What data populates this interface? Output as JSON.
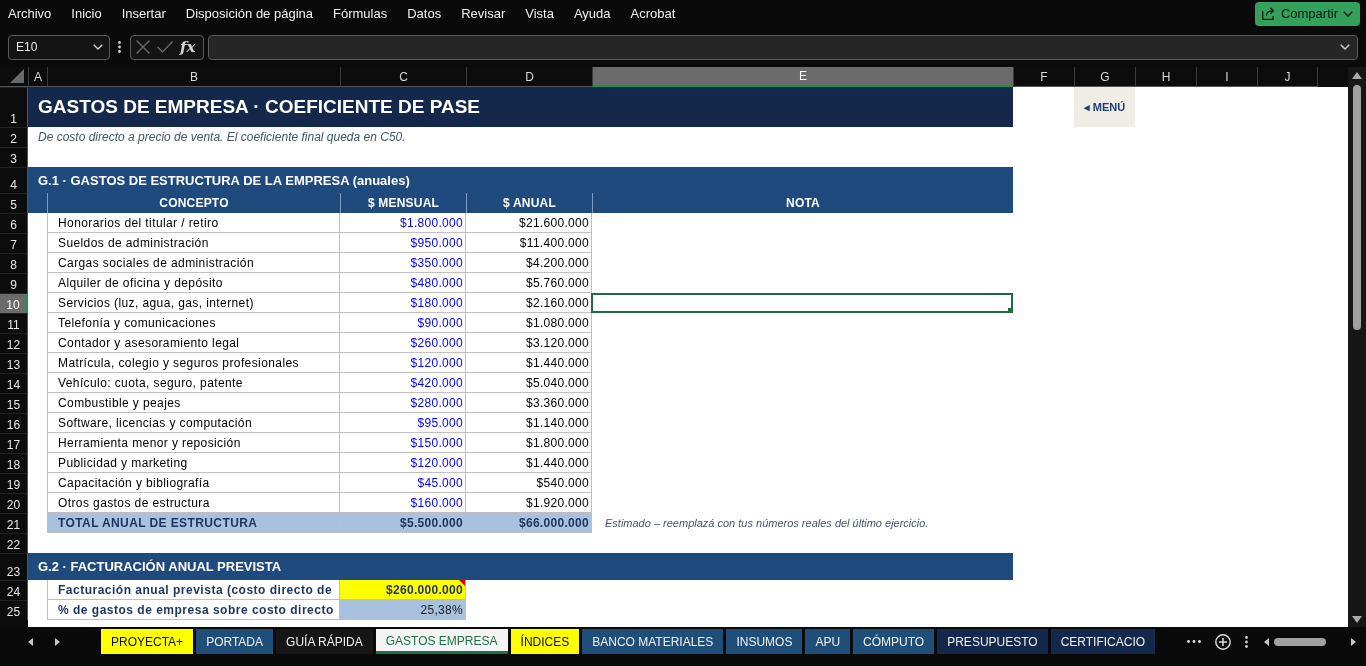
{
  "menu_bar": {
    "items": [
      "Archivo",
      "Inicio",
      "Insertar",
      "Disposición de página",
      "Fórmulas",
      "Datos",
      "Revisar",
      "Vista",
      "Ayuda",
      "Acrobat"
    ],
    "share_button": "Compartir"
  },
  "formula_bar": {
    "name_box": "E10",
    "function_button": "fx"
  },
  "column_headers": [
    {
      "label": "A",
      "selected": false
    },
    {
      "label": "B",
      "selected": false
    },
    {
      "label": "C",
      "selected": false
    },
    {
      "label": "D",
      "selected": false
    },
    {
      "label": "E",
      "selected": true
    },
    {
      "label": "F",
      "selected": false
    },
    {
      "label": "G",
      "selected": false
    },
    {
      "label": "H",
      "selected": false
    },
    {
      "label": "I",
      "selected": false
    },
    {
      "label": "J",
      "selected": false
    }
  ],
  "row_headers": [
    {
      "label": "1",
      "selected": false
    },
    {
      "label": "2",
      "selected": false
    },
    {
      "label": "3",
      "selected": false
    },
    {
      "label": "4",
      "selected": false
    },
    {
      "label": "5",
      "selected": false
    },
    {
      "label": "6",
      "selected": false
    },
    {
      "label": "7",
      "selected": false
    },
    {
      "label": "8",
      "selected": false
    },
    {
      "label": "9",
      "selected": false
    },
    {
      "label": "10",
      "selected": true
    },
    {
      "label": "11",
      "selected": false
    },
    {
      "label": "12",
      "selected": false
    },
    {
      "label": "13",
      "selected": false
    },
    {
      "label": "14",
      "selected": false
    },
    {
      "label": "15",
      "selected": false
    },
    {
      "label": "16",
      "selected": false
    },
    {
      "label": "17",
      "selected": false
    },
    {
      "label": "18",
      "selected": false
    },
    {
      "label": "19",
      "selected": false
    },
    {
      "label": "20",
      "selected": false
    },
    {
      "label": "21",
      "selected": false
    },
    {
      "label": "22",
      "selected": false
    },
    {
      "label": "23",
      "selected": false
    },
    {
      "label": "24",
      "selected": false
    },
    {
      "label": "25",
      "selected": false
    }
  ],
  "sheet": {
    "title": "GASTOS DE EMPRESA · COEFICIENTE DE PASE",
    "subtitle": "De costo directo a precio de venta. El coeficiente final queda en C50.",
    "menu_link": "◂ MENÚ",
    "g1": {
      "heading": "G.1 · GASTOS DE ESTRUCTURA DE LA EMPRESA (anuales)",
      "columns": [
        "CONCEPTO",
        "$ MENSUAL",
        "$ ANUAL",
        "NOTA"
      ],
      "rows": [
        {
          "concept": "Honorarios del titular / retiro",
          "monthly": "$1.800.000",
          "annual": "$21.600.000",
          "note_selected": false
        },
        {
          "concept": "Sueldos de administración",
          "monthly": "$950.000",
          "annual": "$11.400.000",
          "note_selected": false
        },
        {
          "concept": "Cargas sociales de administración",
          "monthly": "$350.000",
          "annual": "$4.200.000",
          "note_selected": false
        },
        {
          "concept": "Alquiler de oficina y depósito",
          "monthly": "$480.000",
          "annual": "$5.760.000",
          "note_selected": false
        },
        {
          "concept": "Servicios (luz, agua, gas, internet)",
          "monthly": "$180.000",
          "annual": "$2.160.000",
          "note_selected": true
        },
        {
          "concept": "Telefonía y comunicaciones",
          "monthly": "$90.000",
          "annual": "$1.080.000",
          "note_selected": false
        },
        {
          "concept": "Contador y asesoramiento legal",
          "monthly": "$260.000",
          "annual": "$3.120.000",
          "note_selected": false
        },
        {
          "concept": "Matrícula, colegio y seguros profesionales",
          "monthly": "$120.000",
          "annual": "$1.440.000",
          "note_selected": false
        },
        {
          "concept": "Vehículo: cuota, seguro, patente",
          "monthly": "$420.000",
          "annual": "$5.040.000",
          "note_selected": false
        },
        {
          "concept": "Combustible y peajes",
          "monthly": "$280.000",
          "annual": "$3.360.000",
          "note_selected": false
        },
        {
          "concept": "Software, licencias y computación",
          "monthly": "$95.000",
          "annual": "$1.140.000",
          "note_selected": false
        },
        {
          "concept": "Herramienta menor y reposición",
          "monthly": "$150.000",
          "annual": "$1.800.000",
          "note_selected": false
        },
        {
          "concept": "Publicidad y marketing",
          "monthly": "$120.000",
          "annual": "$1.440.000",
          "note_selected": false
        },
        {
          "concept": "Capacitación y bibliografía",
          "monthly": "$45.000",
          "annual": "$540.000",
          "note_selected": false
        },
        {
          "concept": "Otros gastos de estructura",
          "monthly": "$160.000",
          "annual": "$1.920.000",
          "note_selected": false
        }
      ],
      "total": {
        "label": "TOTAL ANUAL DE ESTRUCTURA",
        "monthly": "$5.500.000",
        "annual": "$66.000.000",
        "note": "Estimado – reemplazá con tus números reales del último ejercicio."
      }
    },
    "g2": {
      "heading": "G.2 · FACTURACIÓN ANUAL PREVISTA",
      "rows": [
        {
          "kind": "input",
          "label": "Facturación anual prevista (costo directo de",
          "value": "$260.000.000",
          "has_comment": true
        },
        {
          "kind": "calculated",
          "label": "% de gastos de empresa sobre costo directo",
          "value": "25,38%",
          "has_comment": false
        }
      ]
    }
  },
  "sheet_tabs": [
    {
      "label": "PROYECTA+",
      "color": "#ffff00",
      "selected": false
    },
    {
      "label": "PORTADA",
      "color": "#1f4e79",
      "selected": false
    },
    {
      "label": "GUÍA RÁPIDA",
      "color": "#161616",
      "selected": false
    },
    {
      "label": "GASTOS EMPRESA",
      "color": "#1e7145",
      "selected": true
    },
    {
      "label": "ÍNDICES",
      "color": "#ffff00",
      "selected": false
    },
    {
      "label": "BANCO MATERIALES",
      "color": "#1f4e79",
      "selected": false
    },
    {
      "label": "INSUMOS",
      "color": "#1f4e79",
      "selected": false
    },
    {
      "label": "APU",
      "color": "#1f4e79",
      "selected": false
    },
    {
      "label": "CÓMPUTO",
      "color": "#1f4e79",
      "selected": false
    },
    {
      "label": "PRESUPUESTO",
      "color": "#14284b",
      "selected": false
    },
    {
      "label": "CERTIFICACIO",
      "color": "#14284b",
      "selected": false
    }
  ]
}
